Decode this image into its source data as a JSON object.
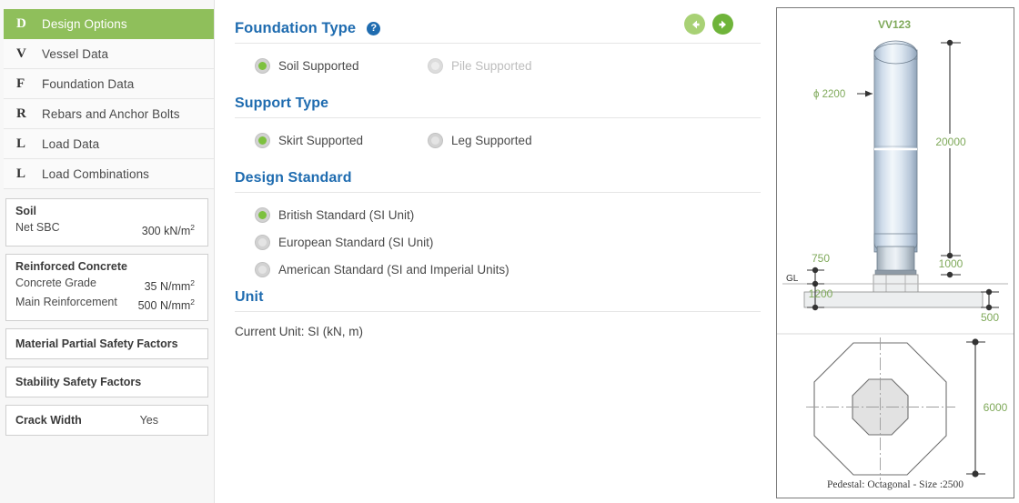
{
  "sidebar": {
    "nav_items": [
      {
        "letter": "D",
        "label": "Design Options",
        "active": true
      },
      {
        "letter": "V",
        "label": "Vessel Data",
        "active": false
      },
      {
        "letter": "F",
        "label": "Foundation Data",
        "active": false
      },
      {
        "letter": "R",
        "label": "Rebars and Anchor Bolts",
        "active": false
      },
      {
        "letter": "L",
        "label": "Load Data",
        "active": false
      },
      {
        "letter": "L",
        "label": "Load Combinations",
        "active": false
      }
    ],
    "panels": [
      {
        "title": "Soil",
        "rows": [
          {
            "label": "Net SBC",
            "value": "300 kN/m",
            "sup": "2"
          }
        ]
      },
      {
        "title": "Reinforced Concrete",
        "rows": [
          {
            "label": "Concrete Grade",
            "value": "35 N/mm",
            "sup": "2"
          },
          {
            "label": "Main Reinforcement",
            "value": "500 N/mm",
            "sup": "2"
          }
        ]
      },
      {
        "title": "Material Partial Safety Factors",
        "rows": []
      },
      {
        "title": "Stability Safety Factors",
        "rows": []
      },
      {
        "title": "Crack Width",
        "value": "Yes",
        "rows": []
      }
    ]
  },
  "main": {
    "foundation_type": {
      "title": "Foundation Type",
      "help_glyph": "?",
      "options": [
        {
          "label": "Soil Supported",
          "selected": true,
          "disabled": false
        },
        {
          "label": "Pile Supported",
          "selected": false,
          "disabled": true
        }
      ]
    },
    "support_type": {
      "title": "Support Type",
      "options": [
        {
          "label": "Skirt Supported",
          "selected": true,
          "disabled": false
        },
        {
          "label": "Leg Supported",
          "selected": false,
          "disabled": false
        }
      ]
    },
    "design_standard": {
      "title": "Design Standard",
      "options": [
        {
          "label": "British Standard (SI Unit)",
          "selected": true
        },
        {
          "label": "European Standard (SI Unit)",
          "selected": false
        },
        {
          "label": "American Standard (SI and Imperial Units)",
          "selected": false
        }
      ]
    },
    "unit": {
      "title": "Unit",
      "current": "Current Unit: SI (kN, m)"
    },
    "nav": {
      "prev": "previous-page",
      "next": "next-page"
    }
  },
  "drawing": {
    "vessel_tag": "VV123",
    "diameter_label": "ϕ 2200",
    "dimensions": {
      "vessel_height": "20000",
      "skirt_height": "1000",
      "pedestal_above_gl": "750",
      "pedestal_below_gl": "1200",
      "footing_thickness": "500",
      "footing_width": "6000"
    },
    "ground_level_label": "GL",
    "caption": "Pedestal: Octagonal - Size :2500"
  },
  "colors": {
    "accent_green": "#8fbf5b",
    "heading_blue": "#1f6cb0",
    "dimension_green": "#7fa95a",
    "radio_green": "#7dc13f"
  }
}
